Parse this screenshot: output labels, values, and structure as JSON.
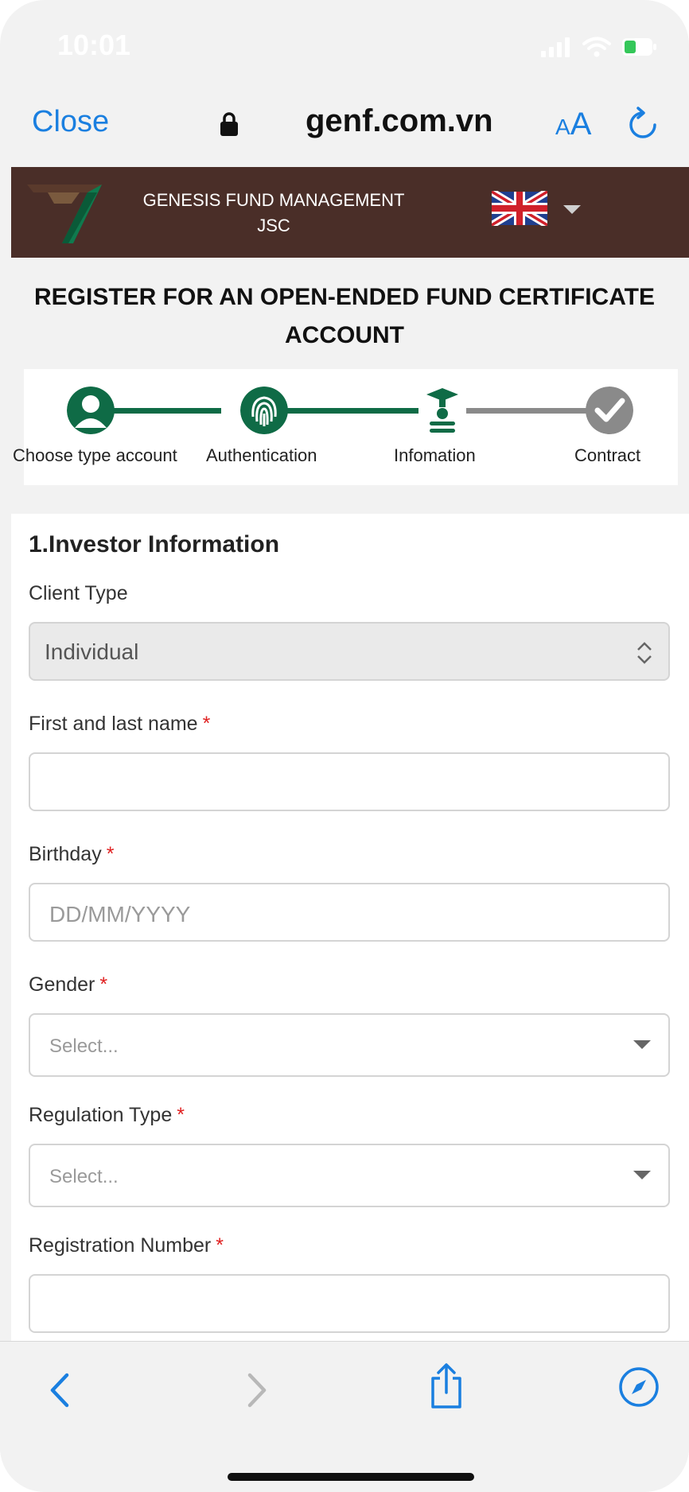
{
  "status_bar": {
    "time": "10:01"
  },
  "browser": {
    "close_label": "Close",
    "domain": "genf.com.vn",
    "text_size_label": "AA"
  },
  "site_header": {
    "brand_line1": "GENESIS FUND MANAGEMENT",
    "brand_line2": "JSC",
    "language_flag": "uk-flag-icon"
  },
  "page": {
    "title_line1": "REGISTER FOR AN OPEN-ENDED FUND CERTIFICATE",
    "title_line2": "ACCOUNT"
  },
  "stepper": {
    "steps": [
      {
        "label": "Choose type account",
        "icon": "user-icon",
        "state": "done"
      },
      {
        "label": "Authentication",
        "icon": "fingerprint-icon",
        "state": "done"
      },
      {
        "label": "Infomation",
        "icon": "graduate-icon",
        "state": "current"
      },
      {
        "label": "Contract",
        "icon": "check-icon",
        "state": "pending"
      }
    ],
    "colors": {
      "active": "#0f6b46",
      "pending": "#8a8a8a"
    }
  },
  "form": {
    "section_title": "1.Investor Information",
    "client_type": {
      "label": "Client Type",
      "value": "Individual"
    },
    "full_name": {
      "label": "First and last name",
      "required_mark": "*",
      "value": ""
    },
    "birthday": {
      "label": "Birthday",
      "required_mark": "*",
      "placeholder": "DD/MM/YYYY"
    },
    "gender": {
      "label": "Gender",
      "required_mark": "*",
      "placeholder": "Select..."
    },
    "regulation_type": {
      "label": "Regulation Type",
      "required_mark": "*",
      "placeholder": "Select..."
    },
    "registration_number": {
      "label": "Registration Number",
      "required_mark": "*",
      "value": ""
    }
  },
  "colors": {
    "accent": "#1a7fe0",
    "header_bg": "#4a2e28",
    "required": "#e02020"
  }
}
